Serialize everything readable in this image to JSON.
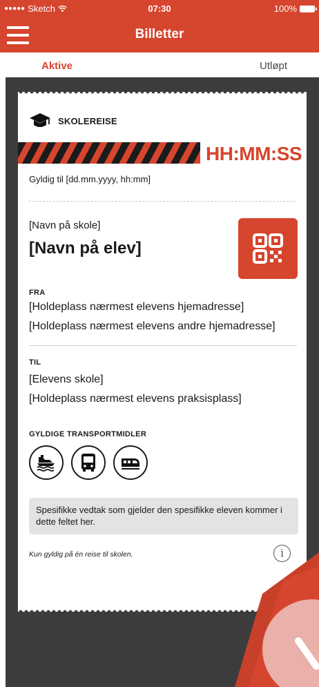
{
  "status_bar": {
    "carrier": "Sketch",
    "signal_dots": "●●●●●",
    "time": "07:30",
    "battery": "100%"
  },
  "nav": {
    "title": "Billetter",
    "menu_icon": "hamburger-icon"
  },
  "tabs": [
    {
      "label": "Aktive",
      "active": true
    },
    {
      "label": "Utløpt",
      "active": false
    }
  ],
  "ticket": {
    "type_icon": "graduation-cap-icon",
    "type_label": "SKOLEREISE",
    "countdown": "HH:MM:SS",
    "valid_to": "Gyldig til [dd.mm.yyyy, hh:mm]",
    "school_name": "[Navn på skole]",
    "student_name": "[Navn på elev]",
    "qr_icon": "qr-code-icon",
    "from": {
      "label": "FRA",
      "lines": [
        "[Holdeplass nærmest elevens hjemadresse]",
        "[Holdeplass nærmest elevens andre hjemadresse]"
      ]
    },
    "to": {
      "label": "TIL",
      "lines": [
        "[Elevens skole]",
        "[Holdeplass nærmest elevens praksisplass]"
      ]
    },
    "transport": {
      "label": "GYLDIGE TRANSPORTMIDLER",
      "modes": [
        "ferry-icon",
        "bus-icon",
        "train-icon"
      ]
    },
    "note": "Spesifikke vedtak som gjelder den spesifikke eleven kommer i dette feltet her.",
    "footnote": "Kun gyldig på én reise til skolen.",
    "info_symbol": "i"
  },
  "colors": {
    "brand": "#d6452d",
    "dark_bg": "#3c3c3c",
    "note_bg": "#e3e3e3"
  }
}
